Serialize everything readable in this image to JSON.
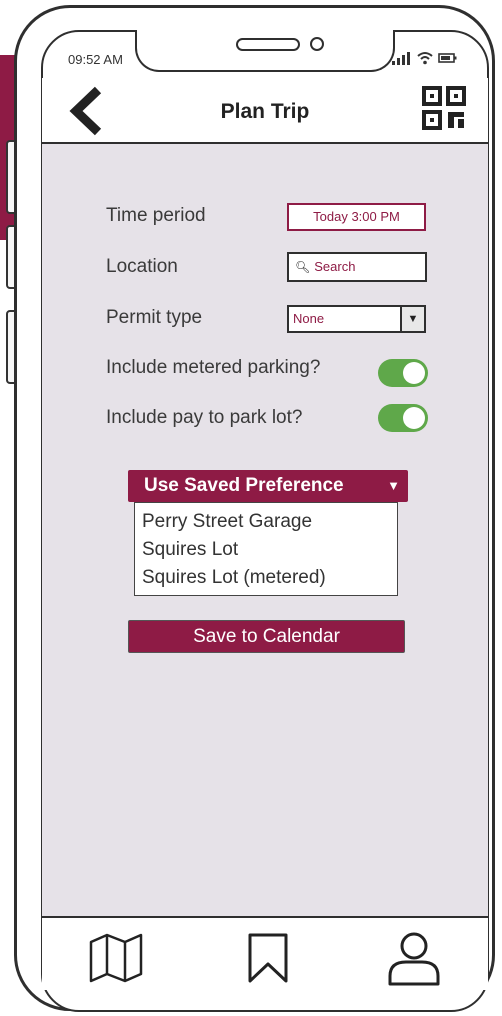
{
  "status_bar": {
    "time": "09:52 AM"
  },
  "header": {
    "title": "Plan Trip"
  },
  "form": {
    "time_period": {
      "label": "Time period",
      "value": "Today 3:00 PM"
    },
    "location": {
      "label": "Location",
      "placeholder": "Search"
    },
    "permit_type": {
      "label": "Permit type",
      "value": "None"
    },
    "metered": {
      "label": "Include metered parking?",
      "on": true
    },
    "pay_lot": {
      "label": "Include pay to park lot?",
      "on": true
    }
  },
  "saved_preference": {
    "button_label": "Use Saved Preference",
    "caret": "▼",
    "items": [
      "Perry Street Garage",
      "Squires Lot",
      "Squires Lot (metered)"
    ]
  },
  "save_calendar_label": "Save to Calendar",
  "icons": {
    "back": "chevron-left-icon",
    "qr": "qr-code-icon",
    "map": "map-icon",
    "bookmark": "bookmark-icon",
    "profile": "user-icon"
  },
  "colors": {
    "accent": "#8e1b45",
    "toggle_on": "#5fa84a",
    "content_bg": "#e6e2e8"
  }
}
